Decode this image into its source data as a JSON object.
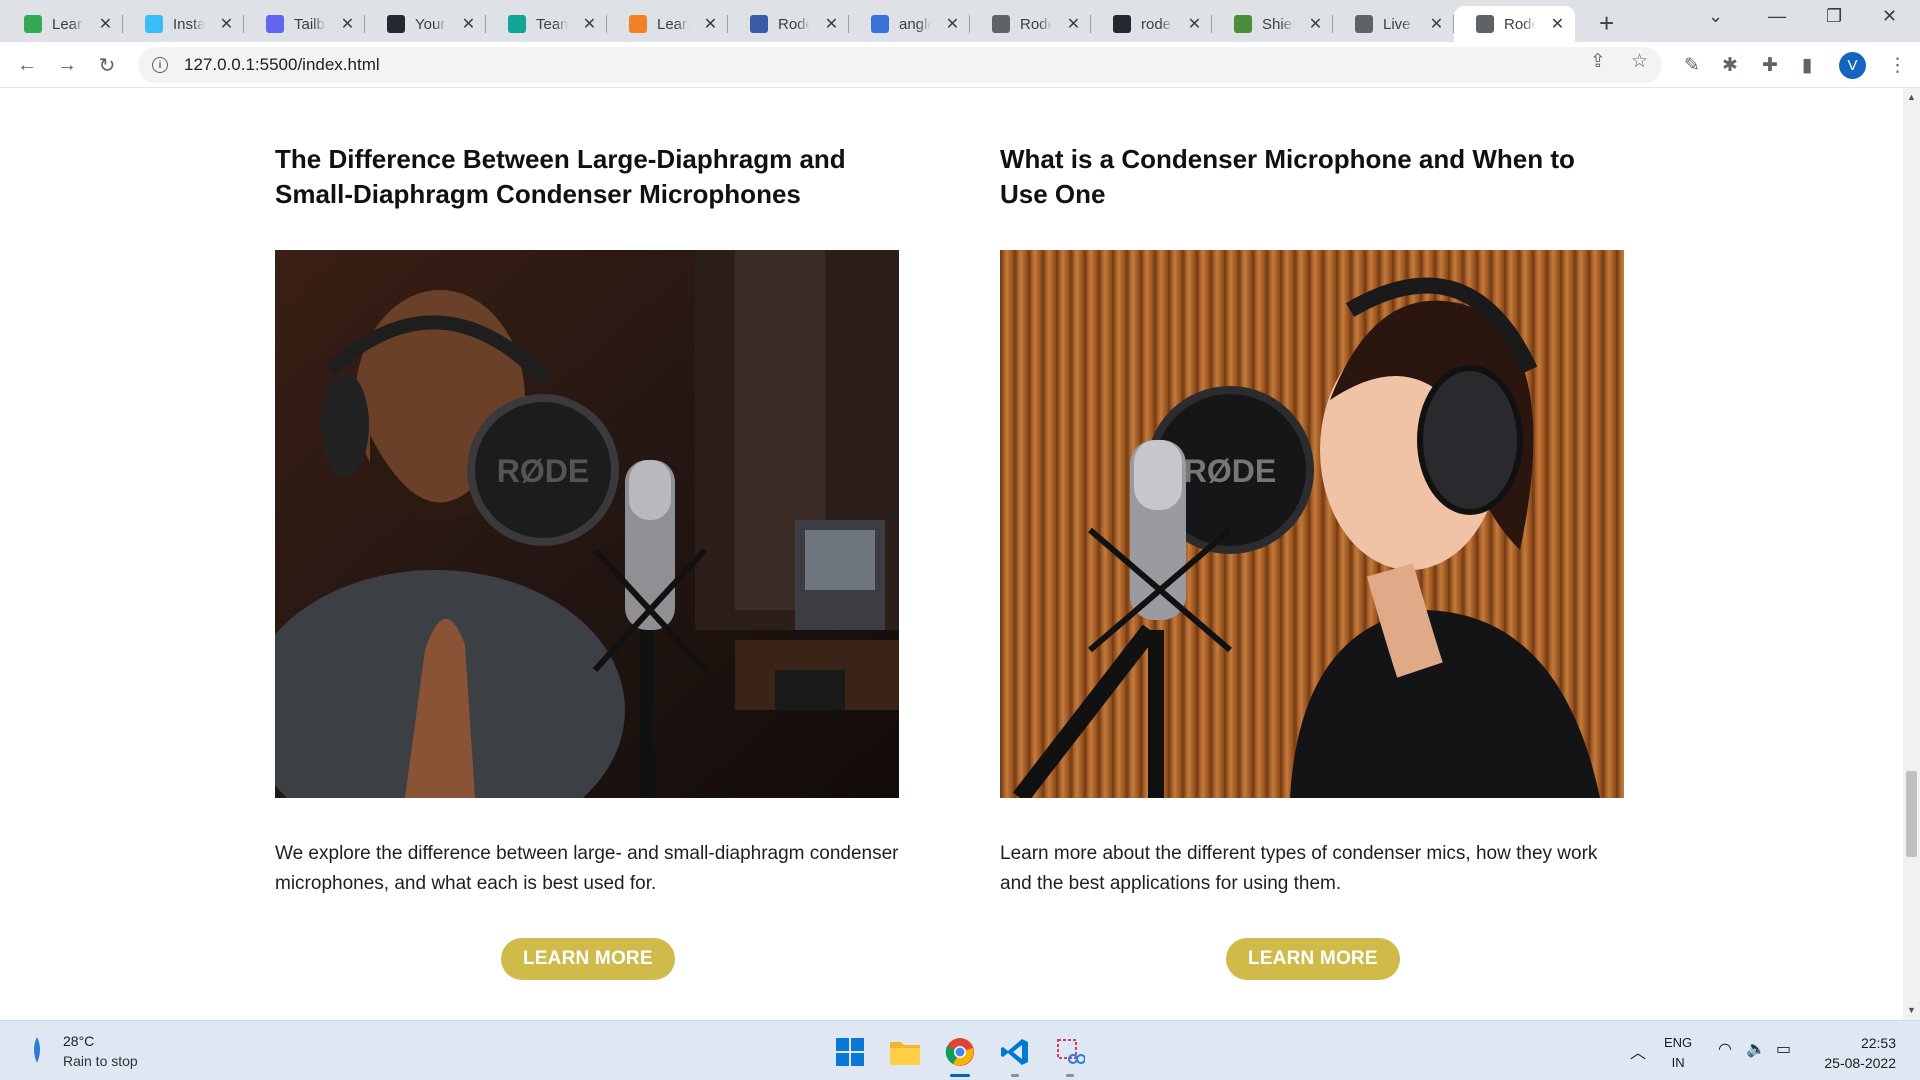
{
  "browser": {
    "tabs": [
      {
        "label": "Learn",
        "icon": "play-icon",
        "color": "#34a853"
      },
      {
        "label": "Install",
        "icon": "tailwind-icon",
        "color": "#38bdf8"
      },
      {
        "label": "Tailblocks",
        "icon": "tailblocks-icon",
        "color": "#6366f1"
      },
      {
        "label": "Your Repositories",
        "icon": "github-icon",
        "color": "#24292f"
      },
      {
        "label": "Team",
        "icon": "diamond-icon",
        "color": "#12a594"
      },
      {
        "label": "Learn",
        "icon": "learn-icon",
        "color": "#f48024"
      },
      {
        "label": "Rode",
        "icon": "code-icon",
        "color": "#3b5ba9"
      },
      {
        "label": "angle",
        "icon": "flag-icon",
        "color": "#3b73d9"
      },
      {
        "label": "Rode",
        "icon": "globe-icon",
        "color": "#5f6368"
      },
      {
        "label": "rode.com",
        "icon": "github-icon",
        "color": "#24292f"
      },
      {
        "label": "Shields",
        "icon": "shield-icon",
        "color": "#4c8c3a"
      },
      {
        "label": "Live Live",
        "icon": "globe-icon",
        "color": "#5f6368"
      },
      {
        "label": "Rode",
        "icon": "globe-icon",
        "color": "#5f6368",
        "active": true
      }
    ],
    "url": "127.0.0.1:5500/index.html",
    "profile_initial": "V"
  },
  "page": {
    "cards": [
      {
        "title": "The Difference Between Large-Diaphragm and Small-Diaphragm Condenser Microphones",
        "image_alt": "Man singing into a RØDE condenser microphone with pop filter",
        "image_text": "RØDE",
        "description": "We explore the difference between large- and small-diaphragm condenser microphones, and what each is best used for.",
        "button": "LEARN MORE"
      },
      {
        "title": "What is a Condenser Microphone and When to Use One",
        "image_alt": "Woman singing into a RØDE condenser microphone in a studio",
        "image_text": "RØDE",
        "description": "Learn more about the different types of condenser mics, how they work and the best applications for using them.",
        "button": "LEARN MORE"
      }
    ],
    "accent_color": "#cfba4a"
  },
  "taskbar": {
    "weather_temp": "28°C",
    "weather_desc": "Rain to stop",
    "apps": [
      "windows-start-icon",
      "file-explorer-icon",
      "chrome-icon",
      "vscode-icon",
      "snipping-tool-icon"
    ],
    "language": "ENG",
    "region": "IN",
    "time": "22:53",
    "date": "25-08-2022"
  }
}
